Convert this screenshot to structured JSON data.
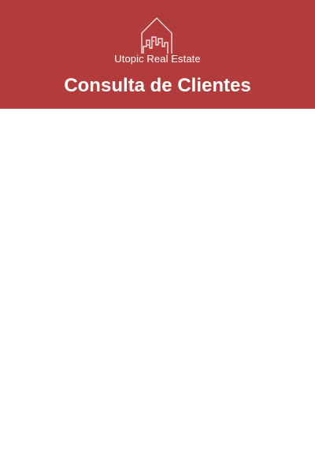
{
  "header": {
    "logo_icon": "house-city-icon",
    "brand_name": "Utopic Real Estate",
    "page_title": "Consulta de Clientes",
    "background_color": "#b23c3b",
    "text_color": "#ffffff"
  }
}
